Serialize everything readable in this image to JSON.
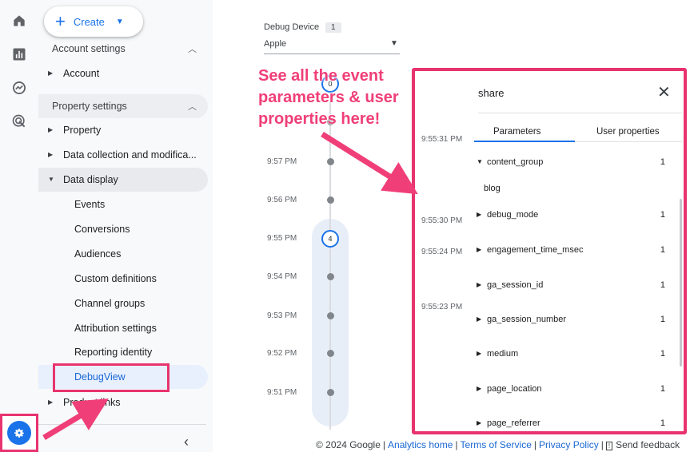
{
  "create": {
    "label": "Create"
  },
  "sidebar": {
    "account_settings": "Account settings",
    "account": "Account",
    "property_settings": "Property settings",
    "property": "Property",
    "data_collection": "Data collection and modifica...",
    "data_display": "Data display",
    "sub_items": [
      "Events",
      "Conversions",
      "Audiences",
      "Custom definitions",
      "Channel groups",
      "Attribution settings",
      "Reporting identity",
      "DebugView"
    ],
    "product_links": "Product links"
  },
  "debug_device": {
    "label": "Debug Device",
    "count": "1",
    "value": "Apple"
  },
  "timeline": {
    "top_count": "0",
    "times": [
      "9:57 PM",
      "9:56 PM",
      "9:55 PM",
      "9:54 PM",
      "9:53 PM",
      "9:52 PM",
      "9:51 PM"
    ],
    "active_count": "4"
  },
  "annotation": {
    "lines": [
      "See all the event",
      "parameters & user",
      "properties here!"
    ]
  },
  "panel": {
    "title": "share",
    "tabs": [
      "Parameters",
      "User properties"
    ],
    "timestamps": [
      "9:55:31 PM",
      "9:55:30 PM",
      "9:55:24 PM",
      "9:55:23 PM"
    ],
    "params": [
      {
        "name": "content_group",
        "count": "1",
        "expanded_value": "blog"
      },
      {
        "name": "debug_mode",
        "count": "1"
      },
      {
        "name": "engagement_time_msec",
        "count": "1"
      },
      {
        "name": "ga_session_id",
        "count": "1"
      },
      {
        "name": "ga_session_number",
        "count": "1"
      },
      {
        "name": "medium",
        "count": "1"
      },
      {
        "name": "page_location",
        "count": "1"
      },
      {
        "name": "page_referrer",
        "count": "1"
      }
    ]
  },
  "footer": {
    "copyright": "© 2024 Google",
    "analytics_home": "Analytics home",
    "terms": "Terms of Service",
    "privacy": "Privacy Policy",
    "feedback": "Send feedback"
  },
  "colors": {
    "accent": "#1a73e8",
    "highlight": "#e8336e",
    "annotation": "#f03f78"
  },
  "icons": [
    "home-icon",
    "reports-icon",
    "explore-icon",
    "advertising-icon",
    "settings-gear-icon",
    "feedback-icon",
    "close-icon",
    "collapse-chevron-icon"
  ]
}
